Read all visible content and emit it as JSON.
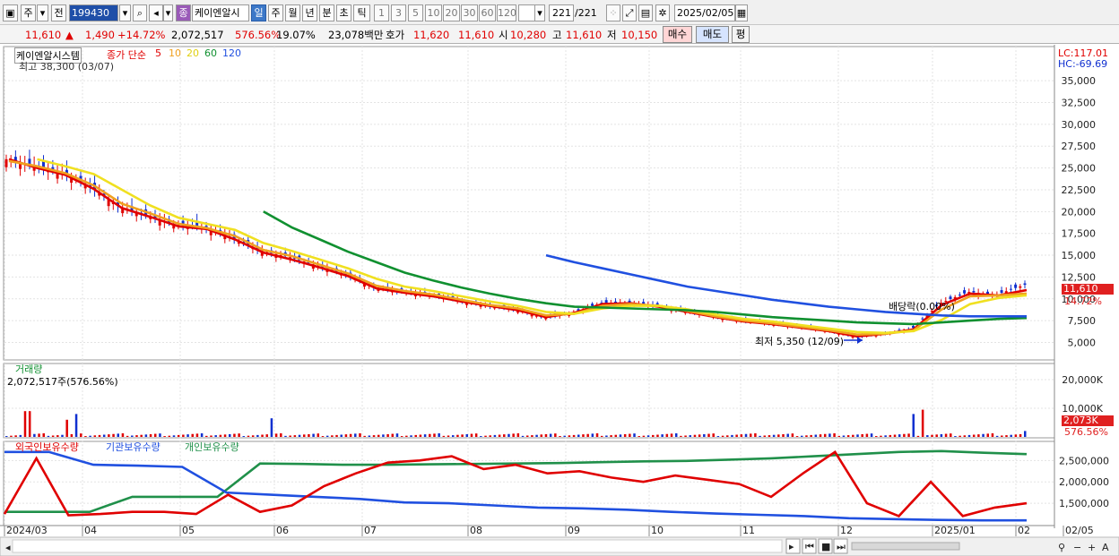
{
  "toolbar": {
    "mode_week": "주",
    "mode_prev": "전",
    "code": "199430",
    "stock_name": "케이엔알시",
    "name_tag": "종",
    "periods": [
      "일",
      "주",
      "월",
      "년",
      "분",
      "초",
      "틱"
    ],
    "active_period": "일",
    "intervals": [
      "1",
      "3",
      "5",
      "10",
      "20",
      "30",
      "60",
      "120"
    ],
    "count": "221",
    "count_total": "/221",
    "date": "2025/02/05"
  },
  "quote": {
    "price": "11,610",
    "change": "1,490",
    "change_pct": "+14.72%",
    "volume": "2,072,517",
    "volume_ratio": "576.56%",
    "turnover": "19.07%",
    "amount": "23,078백만",
    "bid_label": "호가",
    "bid": "11,620",
    "ask": "11,610",
    "open_label": "시",
    "open": "10,280",
    "high_label": "고",
    "high": "11,610",
    "low_label": "저",
    "low": "10,150",
    "buy_button": "매수",
    "sell_button": "매도",
    "eval_button": "평"
  },
  "price_pane": {
    "stock_tag": "케이엔알시스템",
    "legend_title": "종가 단순",
    "ma_periods": [
      "5",
      "10",
      "20",
      "60",
      "120"
    ],
    "ma_colors": [
      "#e00000",
      "#f0a020",
      "#f0e020",
      "#109030",
      "#2050e0"
    ],
    "max_note": "최고 38,300 (03/07)",
    "min_note": "최저 5,350 (12/09)",
    "dividend_note": "배당락(0.00%)",
    "lc": "LC:117.01",
    "hc": "HC:-69.69",
    "price_badge": "11,610",
    "pct_badge": "14.72%",
    "y_ticks": [
      "35,000",
      "32,500",
      "30,000",
      "27,500",
      "25,000",
      "22,500",
      "20,000",
      "17,500",
      "15,000",
      "12,500",
      "10,000",
      "7,500",
      "5,000"
    ]
  },
  "volume_pane": {
    "title": "거래량",
    "value_note": "2,072,517주(576.56%)",
    "y_ticks": [
      "20,000K",
      "10,000K"
    ],
    "badge": "2,073K",
    "pct": "576.56%"
  },
  "holdings_pane": {
    "legend": [
      "외국인보유수량",
      "기관보유수량",
      "개인보유수량"
    ],
    "colors": [
      "#e00000",
      "#2050e0",
      "#20904a"
    ],
    "y_ticks": [
      "2,500,000",
      "2,000,000",
      "1,500,000"
    ]
  },
  "x_axis": {
    "labels": [
      "2024/03",
      "04",
      "05",
      "06",
      "07",
      "08",
      "09",
      "10",
      "11",
      "12",
      "2025/01",
      "02",
      "02/05"
    ]
  },
  "chart_data": {
    "type": "line",
    "title": "",
    "x_range": [
      "2024/03",
      "2025/02/05"
    ],
    "price": {
      "ylim": [
        3000,
        38300
      ],
      "max": {
        "value": 38300,
        "date": "03/07"
      },
      "min": {
        "value": 5350,
        "date": "12/09"
      },
      "last_close": 11610,
      "closes_approx": [
        26000,
        25200,
        24500,
        22800,
        20500,
        19500,
        18500,
        18200,
        17000,
        15500,
        14800,
        13800,
        12800,
        11300,
        10800,
        10500,
        9800,
        9200,
        8800,
        7800,
        8400,
        9500,
        9600,
        9200,
        8600,
        8000,
        7500,
        7200,
        6800,
        6400,
        5600,
        6000,
        6500,
        9500,
        10800,
        10500,
        11610
      ]
    },
    "series": [
      {
        "name": "5",
        "values": [
          26000,
          25000,
          24200,
          22600,
          20400,
          19400,
          18300,
          18000,
          16800,
          15300,
          14500,
          13600,
          12600,
          11200,
          10700,
          10300,
          9700,
          9200,
          8700,
          7900,
          8400,
          9400,
          9500,
          9100,
          8500,
          7900,
          7400,
          7100,
          6700,
          6300,
          5700,
          6000,
          6500,
          9300,
          10600,
          10400,
          11000
        ]
      },
      {
        "name": "10",
        "values": [
          25800,
          25200,
          24400,
          23000,
          20900,
          19800,
          18600,
          18100,
          17200,
          15600,
          14900,
          13900,
          12900,
          11500,
          10900,
          10500,
          9900,
          9300,
          8900,
          8100,
          8300,
          9200,
          9400,
          9200,
          8600,
          8000,
          7500,
          7200,
          6800,
          6400,
          5900,
          6000,
          6400,
          8800,
          10300,
          10400,
          10600
        ]
      },
      {
        "name": "20",
        "values": [
          null,
          26000,
          25200,
          24300,
          22500,
          20700,
          19300,
          18600,
          17900,
          16400,
          15500,
          14500,
          13500,
          12300,
          11400,
          10900,
          10300,
          9700,
          9200,
          8500,
          8300,
          8900,
          9200,
          9200,
          8800,
          8200,
          7700,
          7400,
          7000,
          6600,
          6200,
          6100,
          6300,
          7600,
          9400,
          10100,
          10400
        ]
      },
      {
        "name": "60",
        "values": [
          null,
          null,
          null,
          null,
          null,
          null,
          null,
          null,
          null,
          20000,
          18200,
          16800,
          15400,
          14200,
          13000,
          12100,
          11300,
          10600,
          10000,
          9500,
          9100,
          9000,
          8900,
          8800,
          8700,
          8500,
          8200,
          7900,
          7700,
          7500,
          7300,
          7200,
          7100,
          7300,
          7500,
          7700,
          7800
        ]
      },
      {
        "name": "120",
        "values": [
          null,
          null,
          null,
          null,
          null,
          null,
          null,
          null,
          null,
          null,
          null,
          null,
          null,
          null,
          null,
          null,
          null,
          null,
          null,
          15000,
          14200,
          13500,
          12800,
          12100,
          11400,
          10900,
          10400,
          9900,
          9500,
          9100,
          8800,
          8500,
          8300,
          8100,
          8000,
          8000,
          8000
        ]
      }
    ],
    "volume": {
      "unit": "K",
      "ylim": [
        0,
        25000
      ],
      "last": 2073,
      "spikes_approx": [
        {
          "x": 0.02,
          "v": 9000
        },
        {
          "x": 0.06,
          "v": 6000
        },
        {
          "x": 0.07,
          "v": 8000
        },
        {
          "x": 0.26,
          "v": 6500
        },
        {
          "x": 0.89,
          "v": 8000
        },
        {
          "x": 0.9,
          "v": 9500
        }
      ]
    },
    "holdings": {
      "ylim": [
        1000000,
        2800000
      ],
      "foreign_approx": [
        1250000,
        2550000,
        1220000,
        1250000,
        1300000,
        1300000,
        1250000,
        1700000,
        1300000,
        1450000,
        1900000,
        2200000,
        2450000,
        2500000,
        2600000,
        2300000,
        2400000,
        2200000,
        2250000,
        2100000,
        2000000,
        2150000,
        2050000,
        1950000,
        1650000,
        2200000,
        2700000,
        1500000,
        1200000,
        2000000,
        1200000,
        1400000,
        1500000
      ],
      "institution_approx": [
        2700000,
        2700000,
        2400000,
        2380000,
        2350000,
        1750000,
        1700000,
        1650000,
        1600000,
        1520000,
        1500000,
        1450000,
        1400000,
        1380000,
        1350000,
        1300000,
        1260000,
        1230000,
        1200000,
        1150000,
        1130000,
        1110000,
        1100000,
        1100000
      ],
      "individual_approx": [
        1300000,
        1300000,
        1300000,
        1650000,
        1650000,
        1650000,
        2430000,
        2420000,
        2400000,
        2400000,
        2410000,
        2420000,
        2430000,
        2440000,
        2460000,
        2480000,
        2490000,
        2520000,
        2550000,
        2600000,
        2650000,
        2700000,
        2720000,
        2680000,
        2650000
      ]
    }
  }
}
